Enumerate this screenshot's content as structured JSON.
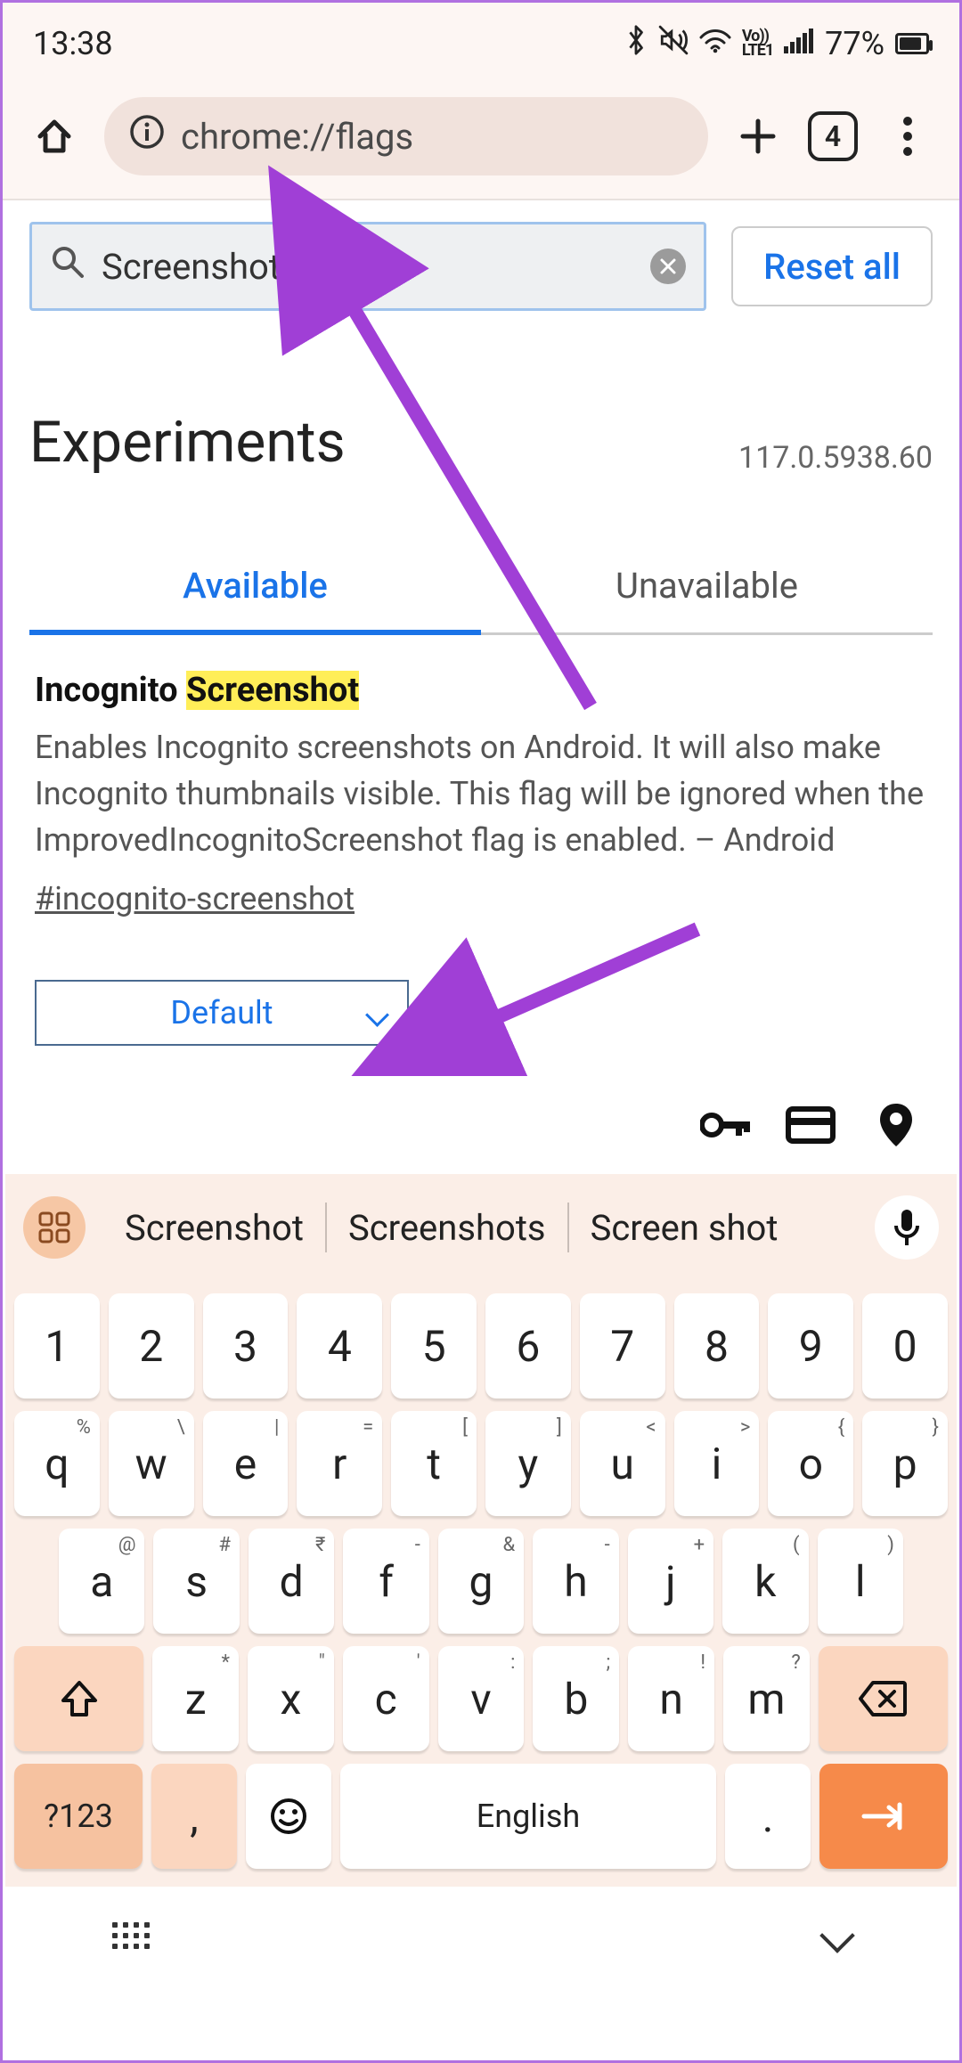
{
  "status": {
    "time": "13:38",
    "battery_pct": "77%"
  },
  "chrome": {
    "url": "chrome://flags",
    "tab_count": "4"
  },
  "flags": {
    "search_value": "Screenshot",
    "reset_label": "Reset all",
    "page_title": "Experiments",
    "version": "117.0.5938.60",
    "tabs": {
      "available": "Available",
      "unavailable": "Unavailable"
    },
    "entry": {
      "title_prefix": "Incognito ",
      "title_highlight": "Screenshot",
      "description": "Enables Incognito screenshots on Android. It will also make Incognito thumbnails visible. This flag will be ignored when the ImprovedIncognitoScreenshot flag is enabled. – Android",
      "hash": "#incognito-screenshot",
      "select_value": "Default"
    }
  },
  "keyboard": {
    "suggestions": [
      "Screenshot",
      "Screenshots",
      "Screen shot"
    ],
    "row_num": [
      "1",
      "2",
      "3",
      "4",
      "5",
      "6",
      "7",
      "8",
      "9",
      "0"
    ],
    "row_q": [
      [
        "q",
        "%"
      ],
      [
        "w",
        "\\"
      ],
      [
        "e",
        "|"
      ],
      [
        "r",
        "="
      ],
      [
        "t",
        "["
      ],
      [
        "y",
        "]"
      ],
      [
        "u",
        "<"
      ],
      [
        "i",
        ">"
      ],
      [
        "o",
        "{"
      ],
      [
        "p",
        "}"
      ]
    ],
    "row_a": [
      [
        "a",
        "@"
      ],
      [
        "s",
        "#"
      ],
      [
        "d",
        "₹"
      ],
      [
        "f",
        "-"
      ],
      [
        "g",
        "&"
      ],
      [
        "h",
        "-"
      ],
      [
        "j",
        "+"
      ],
      [
        "k",
        "("
      ],
      [
        "l",
        ")"
      ]
    ],
    "row_z": [
      [
        "z",
        "*"
      ],
      [
        "x",
        "\""
      ],
      [
        "c",
        "'"
      ],
      [
        "v",
        ":"
      ],
      [
        "b",
        ";"
      ],
      [
        "n",
        "!"
      ],
      [
        "m",
        "?"
      ]
    ],
    "sym_label": "?123",
    "comma": ",",
    "period": ".",
    "space_label": "English"
  }
}
